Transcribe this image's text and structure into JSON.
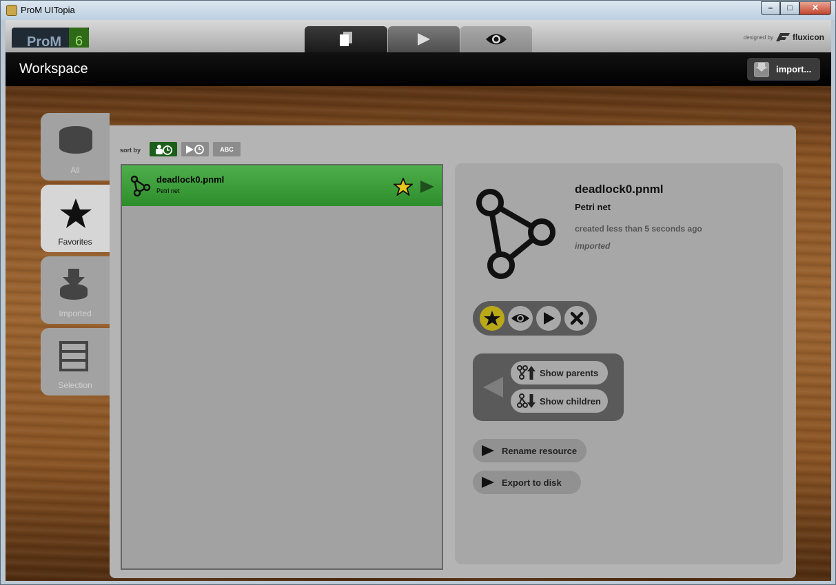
{
  "window": {
    "title": "ProM UITopia",
    "controls": [
      "–",
      "□",
      "✕"
    ]
  },
  "header": {
    "brand": "ProM",
    "version": "6",
    "designed_by": "designed by",
    "company": "fluxicon",
    "workspace_title": "Workspace",
    "import_label": "import..."
  },
  "sidebar": {
    "items": [
      {
        "label": "All",
        "icon": "database-icon"
      },
      {
        "label": "Favorites",
        "icon": "star-icon"
      },
      {
        "label": "Imported",
        "icon": "import-icon"
      },
      {
        "label": "Selection",
        "icon": "selection-icon"
      }
    ],
    "active": "Favorites"
  },
  "sort": {
    "label": "sort by",
    "options": [
      "creation-time",
      "last-used",
      "ABC"
    ],
    "abc_label": "ABC"
  },
  "list": {
    "items": [
      {
        "title": "deadlock0.pnml",
        "subtitle": "Petri net",
        "favorite": true
      }
    ]
  },
  "detail": {
    "title": "deadlock0.pnml",
    "type": "Petri net",
    "created": "created less than 5 seconds ago",
    "origin": "imported",
    "show_parents": "Show parents",
    "show_children": "Show children",
    "rename": "Rename resource",
    "export": "Export to disk"
  },
  "colors": {
    "accent_green": "#3a9a37",
    "star_yellow": "#e8c81a",
    "panel_gray": "#b4b4b4"
  }
}
